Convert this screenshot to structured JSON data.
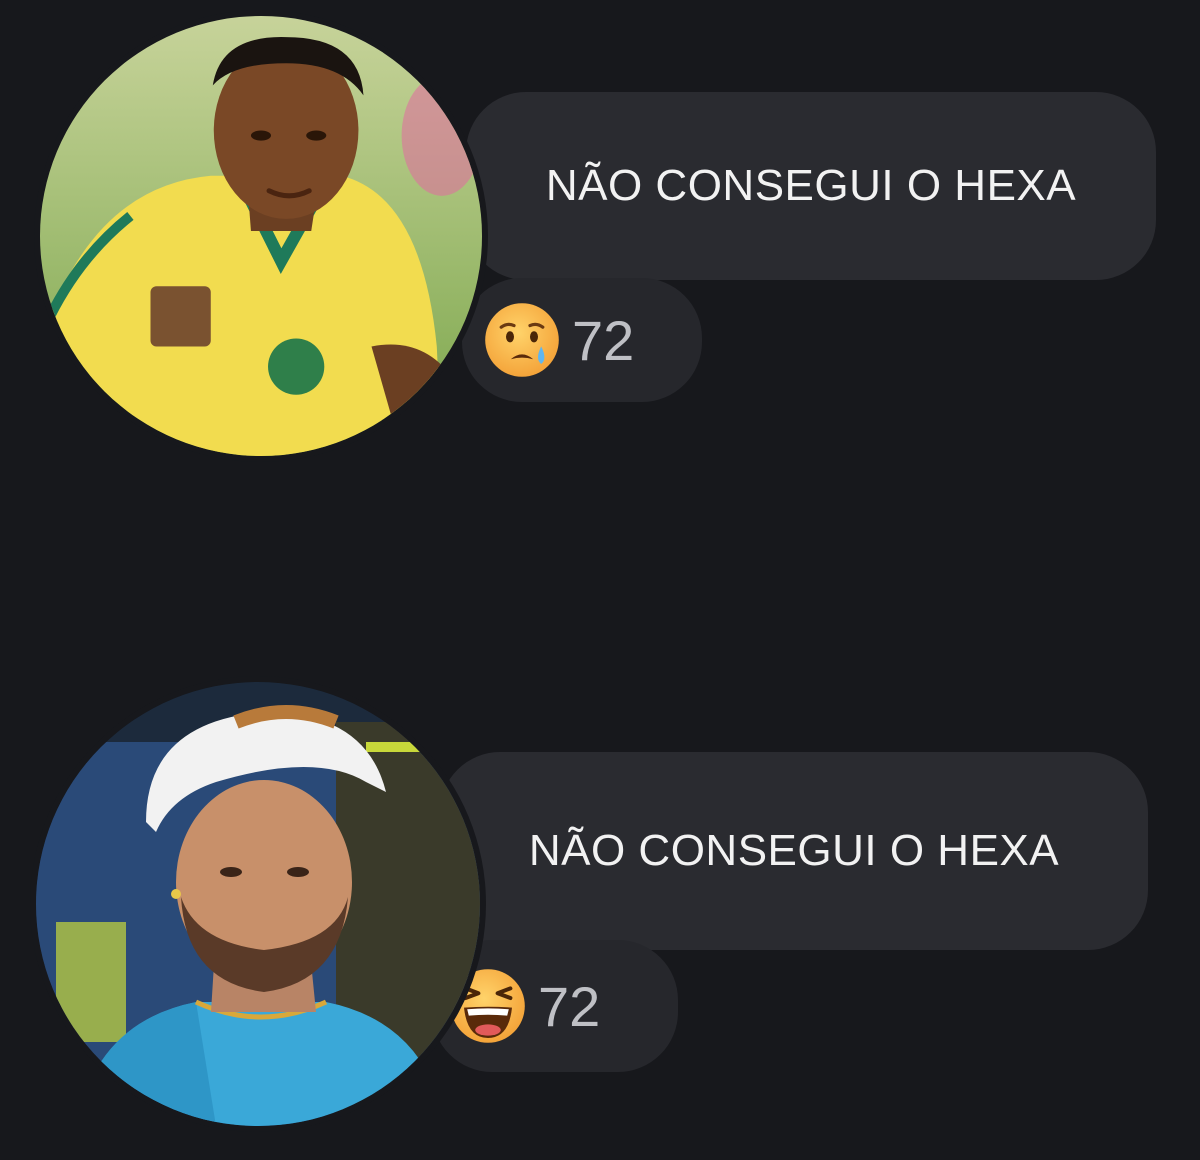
{
  "messages": [
    {
      "text": "NÃO CONSEGUI O HEXA",
      "reaction": {
        "icon": "sad-tear-face-icon",
        "count": "72"
      },
      "avatar": {
        "description_icon": "player-yellow-jersey-avatar"
      }
    },
    {
      "text": "NÃO CONSEGUI O HEXA",
      "reaction": {
        "icon": "laughing-face-icon",
        "count": "72"
      },
      "avatar": {
        "description_icon": "player-white-cap-avatar"
      }
    }
  ],
  "colors": {
    "background": "#17181c",
    "bubble": "#2a2b30",
    "reaction_pill": "#26272c",
    "text": "#f2f2f2",
    "count": "#bfc0c5"
  }
}
